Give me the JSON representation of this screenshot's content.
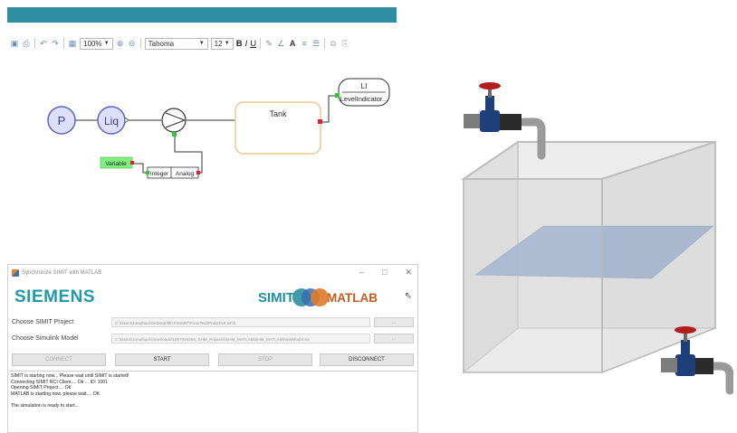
{
  "editor": {
    "toolbar": {
      "zoom": "100%",
      "font": "Tahoma",
      "size": "12",
      "bold": "B",
      "italic": "I",
      "underline": "U"
    },
    "diagram": {
      "p_label": "P",
      "liq_label": "Liq",
      "tank_label": "Tank",
      "li_tag": "LI",
      "li_name": "LevelIndicator...",
      "variable_label": "Variable",
      "integer_label": "Integer",
      "analog_label": "Analog"
    }
  },
  "sync_window": {
    "title": "Synchronize SIMIT with MATLAB",
    "brand": "SIEMENS",
    "logo_simit": "SIMIT",
    "logo_matlab": "MATLAB",
    "project_label": "Choose SIMIT Project",
    "project_path": "C:\\Users\\Jonathan\\Desktop\\MCS\\SIMIT\\ProtoTest\\ProtoTest.simit",
    "model_label": "Choose Simulink Model",
    "model_path": "C:\\Users\\Jonathan\\Downloads\\1057016256_SHM_Projects\\SHM_MATLAB\\SHM_MATLAB\\NewModel.slx",
    "browse": "...",
    "buttons": {
      "connect": "CONNECT",
      "start": "START",
      "stop": "STOP",
      "disconnect": "DISCONNECT"
    },
    "log": [
      "SIMIT is starting now... Please wait until SIMIT is started!",
      "Connecting SIMIT RCI Client.... Ok ... ID: 1001",
      "Opening SIMIT Project.... Ok",
      "MATLAB is starting now, please wait.... OK",
      "",
      "The simulation is ready to start..."
    ]
  },
  "colors": {
    "titlebar": "#2f8ea3",
    "siemens": "#1f9aa9",
    "matlab": "#c65b1d",
    "node_fill": "#dde0f8",
    "node_stroke": "#5b64c8",
    "tank_border": "#f2c88a",
    "liquid": "#5f86c6"
  }
}
